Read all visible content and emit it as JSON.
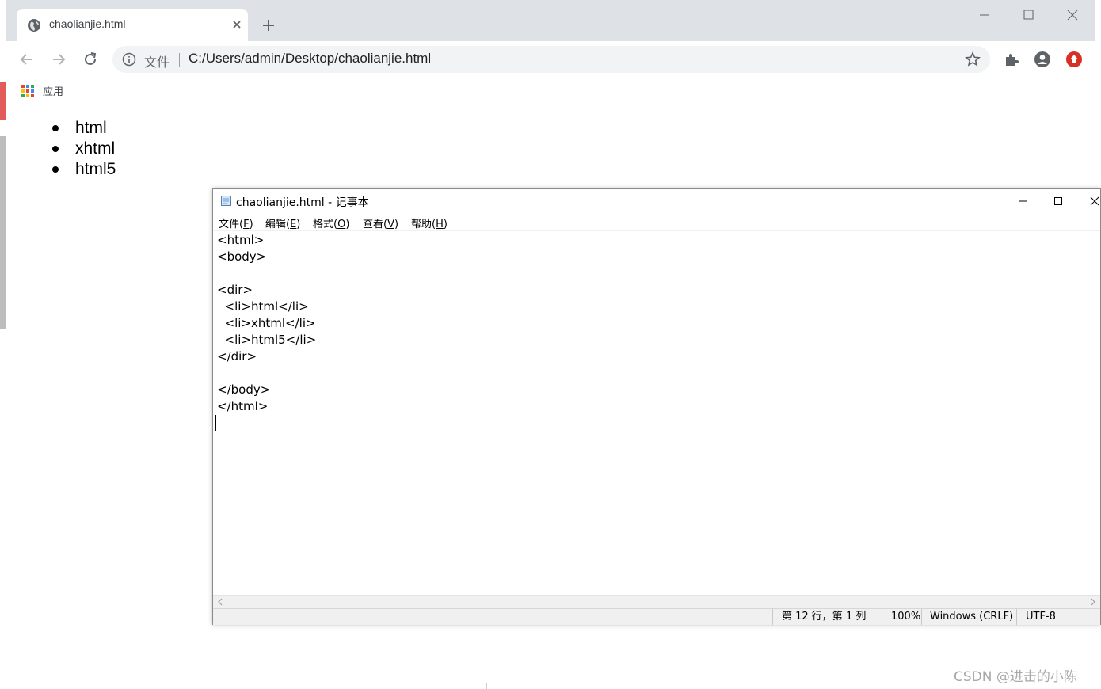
{
  "browser": {
    "tab": {
      "title": "chaolianjie.html"
    },
    "omnibox": {
      "scheme_label": "文件",
      "url": "C:/Users/admin/Desktop/chaolianjie.html"
    },
    "bookmarks": {
      "apps_label": "应用"
    }
  },
  "page_content": {
    "list_items": [
      "html",
      "xhtml",
      "html5"
    ]
  },
  "notepad": {
    "title": "chaolianjie.html - 记事本",
    "menu": [
      {
        "label": "文件(",
        "key": "F",
        "end": ")"
      },
      {
        "label": "编辑(",
        "key": "E",
        "end": ")"
      },
      {
        "label": "格式(",
        "key": "O",
        "end": ")"
      },
      {
        "label": "查看(",
        "key": "V",
        "end": ")"
      },
      {
        "label": "帮助(",
        "key": "H",
        "end": ")"
      }
    ],
    "text": "<html>\n<body>\n\n<dir>\n  <li>html</li>\n  <li>xhtml</li>\n  <li>html5</li>\n</dir>\n\n</body>\n</html>\n",
    "status": {
      "position": "第 12 行，第 1 列",
      "zoom": "100%",
      "line_ending": "Windows (CRLF)",
      "encoding": "UTF-8"
    }
  },
  "watermark": "CSDN @进击的小陈",
  "colors": {
    "tabstrip": "#dee1e6",
    "omnibox": "#f1f3f4",
    "profile_update": "#d93025"
  }
}
